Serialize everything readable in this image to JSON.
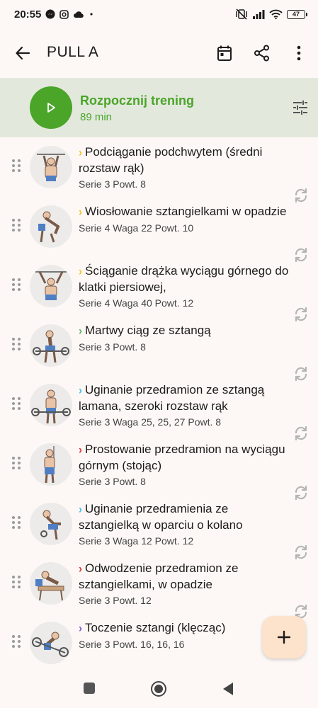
{
  "status": {
    "time": "20:55",
    "battery": "47"
  },
  "appbar": {
    "title": "PULL A"
  },
  "start": {
    "title": "Rozpocznij trening",
    "duration": "89 min"
  },
  "colors": {
    "accent_green": "#4aa528",
    "chev_yellow": "#f2c318",
    "chev_green": "#55b85a",
    "chev_cyan": "#3cc0e6",
    "chev_red": "#e2322b",
    "chev_purple": "#7e57d6"
  },
  "exercises": [
    {
      "chev": "›",
      "chev_color": "#f2c318",
      "name": "Podciąganie podchwytem (średni rozstaw rąk)",
      "detail": "Serie 3 Powt. 8"
    },
    {
      "chev": "›",
      "chev_color": "#f2c318",
      "name": "Wiosłowanie sztangielkami w opadzie",
      "detail": "Serie 4 Waga 22 Powt. 10"
    },
    {
      "chev": "›",
      "chev_color": "#f2c318",
      "name": "Ściąganie drążka wyciągu górnego do klatki piersiowej,",
      "detail": "Serie 4 Waga 40 Powt. 12"
    },
    {
      "chev": "›",
      "chev_color": "#55b85a",
      "name": "Martwy ciąg ze sztangą",
      "detail": "Serie 3 Powt. 8"
    },
    {
      "chev": "›",
      "chev_color": "#3cc0e6",
      "name": "Uginanie przedramion ze sztangą lamana, szeroki rozstaw rąk",
      "detail": "Serie 3 Waga 25, 25, 27 Powt. 8"
    },
    {
      "chev": "›",
      "chev_color": "#e2322b",
      "name": "Prostowanie przedramion na wyciągu górnym (stojąc)",
      "detail": "Serie 3 Powt. 8"
    },
    {
      "chev": "›",
      "chev_color": "#3cc0e6",
      "name": "Uginanie przedramienia ze sztangielką w oparciu o kolano",
      "detail": "Serie 3 Waga 12 Powt. 12"
    },
    {
      "chev": "›",
      "chev_color": "#e2322b",
      "name": "Odwodzenie przedramion ze sztangielkami, w opadzie",
      "detail": "Serie 3 Powt. 12"
    },
    {
      "chev": "›",
      "chev_color": "#7e57d6",
      "name": "Toczenie sztangi (klęcząc)",
      "detail": "Serie 3 Powt. 16, 16, 16"
    }
  ],
  "fab": {
    "label": "+"
  }
}
